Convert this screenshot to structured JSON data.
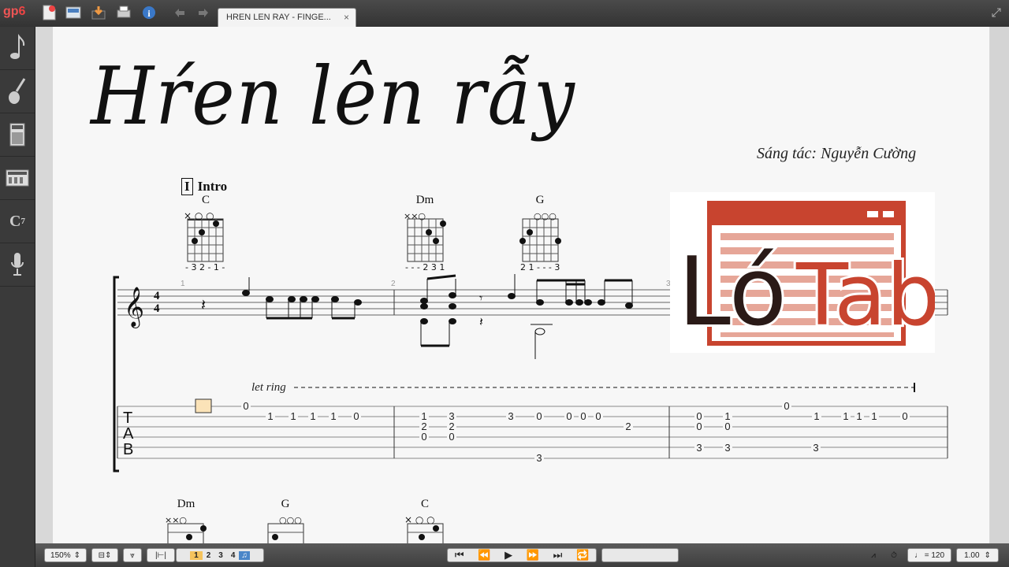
{
  "app": {
    "logo_text": "gp",
    "logo_version": "6"
  },
  "toolbar": {
    "icons": [
      "new-file-icon",
      "open-icon",
      "save-icon",
      "print-icon",
      "info-icon",
      "undo-icon",
      "redo-icon"
    ]
  },
  "tab": {
    "title": "HREN LEN RAY - FINGE...",
    "close": "×"
  },
  "sidebar": {
    "icons": [
      "note-icon",
      "guitar-icon",
      "amp-icon",
      "mixer-icon",
      "chord-icon",
      "mic-icon"
    ],
    "chord_label": "C",
    "chord_sup": "7"
  },
  "score": {
    "title": "Hŕen lên rẫy",
    "composer": "Sáng tác: Nguyễn Cường",
    "section_number": "I",
    "section_name": "Intro",
    "time_sig_top": "4",
    "time_sig_bottom": "4",
    "let_ring": "let ring",
    "tab_letters": [
      "T",
      "A",
      "B"
    ],
    "bar_numbers": [
      "1",
      "2",
      "3"
    ],
    "chords_row1": [
      {
        "name": "C",
        "fingering": "- 3 2 - 1 -",
        "markers": "×  ○ ○"
      },
      {
        "name": "Dm",
        "fingering": "- - - 2 3 1",
        "markers": "××○"
      },
      {
        "name": "G",
        "fingering": "2 1 - - - 3",
        "markers": "○○○"
      }
    ],
    "chords_row2": [
      {
        "name": "Dm",
        "markers": "××○"
      },
      {
        "name": "G",
        "markers": "○○○"
      },
      {
        "name": "C",
        "markers": "×  ○ ○"
      }
    ],
    "watermark": {
      "text_lo": "Ló",
      "text_tab": "Tab",
      "color": "#c8442f"
    }
  },
  "tab_numbers": {
    "bar1": [
      "0",
      "1",
      "1",
      "1",
      "1",
      "0"
    ],
    "bar2": [
      "1",
      "2",
      "0",
      "3",
      "2",
      "0",
      "3",
      "0",
      "0",
      "0",
      "0",
      "2",
      "3"
    ],
    "bar3": [
      "0",
      "0",
      "1",
      "0",
      "0",
      "3",
      "3",
      "3",
      "1",
      "1",
      "1",
      "1",
      "0"
    ]
  },
  "bottom": {
    "zoom": "150%",
    "voices": [
      "1",
      "2",
      "3",
      "4"
    ],
    "tempo": "♩ = 120",
    "speed": "1.00"
  }
}
